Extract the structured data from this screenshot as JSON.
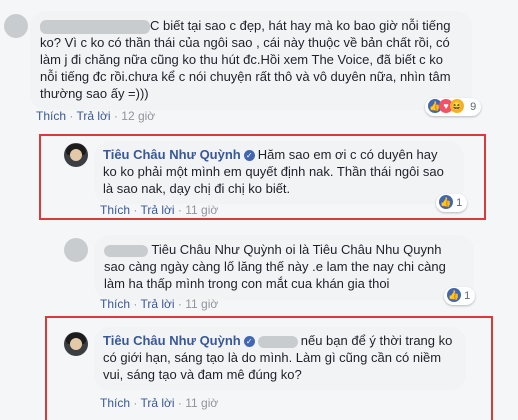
{
  "comment1": {
    "text": "C biết tại sao c đẹp, hát hay mà ko bao giờ nỗi tiếng ko? Vì c ko có thần thái của ngôi sao , cái này thuộc về bản chất rồi, có làm j đi chăng nữa cũng ko thu hút đc.Hồi xem The Voice, đã biết c ko nỗi tiếng đc rồi.chưa kể c nói chuyện rất thô và vô duyên nữa, nhìn tâm thường sao ấy =)))",
    "like_label": "Thích",
    "reply_label": "Trả lời",
    "time": "12 giờ",
    "reaction_count": "9"
  },
  "comment2": {
    "author": "Tiêu Châu Như Quỳnh",
    "text": "Hăm sao em ơi c có duyên hay ko ko phải một mình em quyết định nak. Thần thái ngôi sao là sao nak, dạy chị đi chị ko biết.",
    "like_label": "Thích",
    "reply_label": "Trả lời",
    "time": "11 giờ",
    "reaction_count": "1"
  },
  "comment3": {
    "text": "Tiêu Châu Như Quỳnh oi là Tiêu Châu Nhu Quynh sao càng ngày càng lố lăng thế này .e lam the nay chi càng làm ha thấp mình trong con mắt cua khán gia thoi",
    "like_label": "Thích",
    "reply_label": "Trả lời",
    "time": "11 giờ",
    "reaction_count": "1"
  },
  "comment4": {
    "author": "Tiêu Châu Như Quỳnh",
    "text": "nếu bạn để ý thời trang ko có giới hạn, sáng tạo là do mình. Làm gì cũng cần có niềm vui, sáng tạo và đam mê đúng ko?",
    "like_label": "Thích",
    "reply_label": "Trả lời",
    "time": "11 giờ"
  },
  "separator": "·",
  "icons": {
    "verified": "verified-badge-icon",
    "like": "like-reaction-icon",
    "heart": "heart-reaction-icon",
    "haha": "haha-reaction-icon"
  },
  "colors": {
    "link": "#385898",
    "highlight": "#d93a3a",
    "bubble": "#f2f3f5"
  }
}
